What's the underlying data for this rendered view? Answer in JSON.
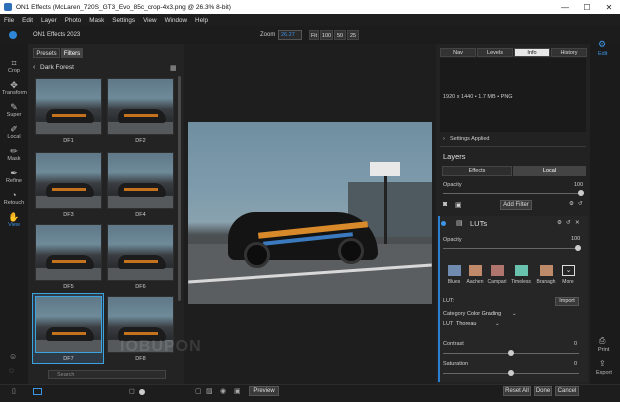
{
  "window": {
    "title": "ON1 Effects  (McLaren_720S_GT3_Evo_85c_crop-4x3.png @ 26.3% 8-bit)",
    "min": "—",
    "max": "☐",
    "close": "✕"
  },
  "menu": [
    "File",
    "Edit",
    "Layer",
    "Photo",
    "Mask",
    "Settings",
    "View",
    "Window",
    "Help"
  ],
  "header": {
    "app_name": "ON1 Effects 2023",
    "zoom_label": "Zoom",
    "zoom_value": "26.27",
    "zoom_options": [
      "Fit",
      "100",
      "50",
      "25"
    ]
  },
  "left_tools": [
    {
      "label": "Crop",
      "icon": "crop-icon"
    },
    {
      "label": "Transform",
      "icon": "transform-icon"
    },
    {
      "label": "Super",
      "icon": "super-icon"
    },
    {
      "label": "Local",
      "icon": "local-icon"
    },
    {
      "label": "Mask",
      "icon": "mask-icon"
    },
    {
      "label": "Refine",
      "icon": "refine-icon"
    },
    {
      "label": "Retouch",
      "icon": "retouch-icon"
    },
    {
      "label": "View",
      "icon": "view-icon"
    }
  ],
  "browser": {
    "tabs": [
      "Presets",
      "Filters"
    ],
    "folder": "Dark Forest",
    "thumbs": [
      "DF1",
      "DF2",
      "DF3",
      "DF4",
      "DF5",
      "DF6",
      "DF7",
      "DF8"
    ],
    "selected": "DF7",
    "search_placeholder": "Search"
  },
  "watermark": "IOBUPON",
  "right": {
    "tabs": [
      "Nav",
      "Levels",
      "Info",
      "History"
    ],
    "active_tab": "Info",
    "info_text": "1920 x 1440 • 1.7 MB • PNG",
    "settings_applied": "Settings Applied",
    "layers_title": "Layers",
    "layer_tabs": [
      "Effects",
      "Local"
    ],
    "opacity_label": "Opacity",
    "opacity_value": "100",
    "add_filter": "Add Filter",
    "lut": {
      "title": "LUTs",
      "opacity_label": "Opacity",
      "opacity_value": "100",
      "swatches": [
        {
          "name": "Blues",
          "color": "#6f8bb0"
        },
        {
          "name": "Aachen",
          "color": "#c08a6a"
        },
        {
          "name": "Campari",
          "color": "#b0766d"
        },
        {
          "name": "Timeless",
          "color": "#69c2ad"
        },
        {
          "name": "Branagh",
          "color": "#bd8b6a"
        },
        {
          "name": "More",
          "color": "#cfcfcf"
        }
      ],
      "lut_label": "LUT:",
      "import_label": "Import",
      "category_label": "Category",
      "category_value": "Color Grading",
      "lut_name_label": "LUT",
      "lut_name_value": "Thoreau",
      "contrast_label": "Contrast",
      "contrast_value": "0",
      "saturation_label": "Saturation",
      "saturation_value": "0"
    }
  },
  "far_right": {
    "edit": "Edit",
    "print": "Print",
    "export": "Export"
  },
  "bottom": {
    "preview": "Preview",
    "reset_all": "Reset All",
    "done": "Done",
    "cancel": "Cancel"
  },
  "colors": {
    "accent": "#3c96e6",
    "selection": "#3aa3e0"
  }
}
